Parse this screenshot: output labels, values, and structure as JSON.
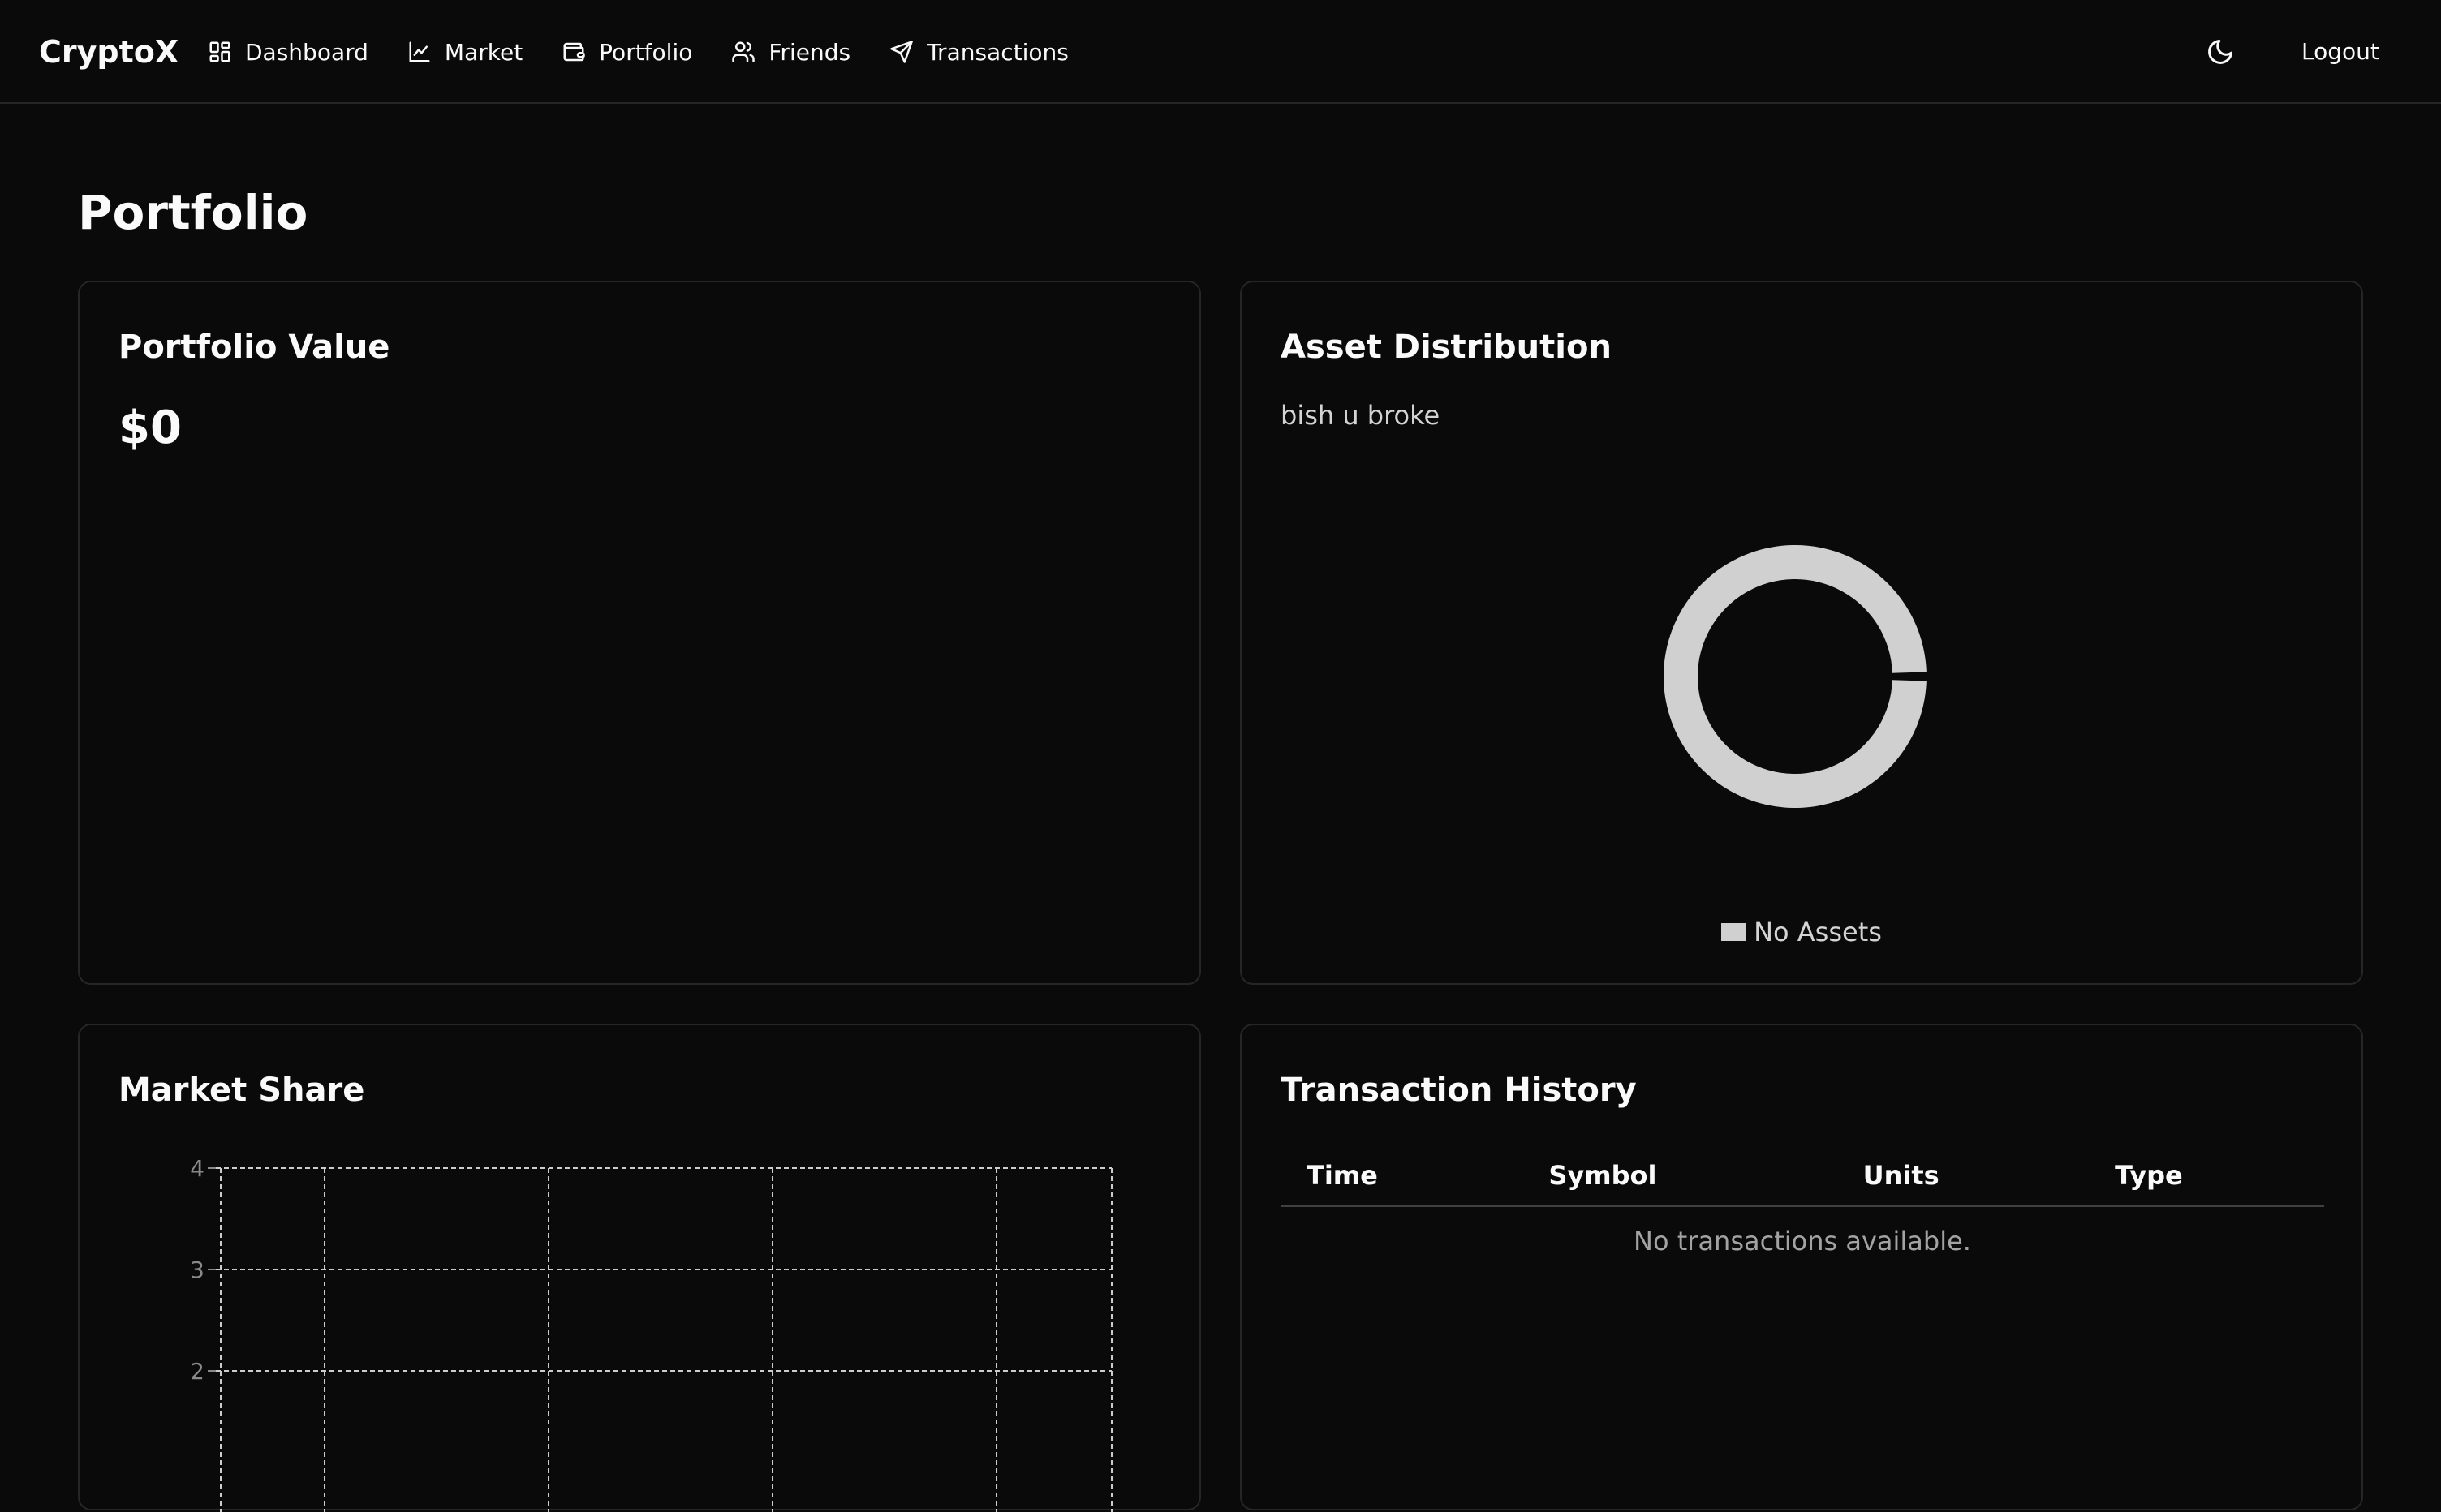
{
  "nav": {
    "brand": "CryptoX",
    "items": [
      {
        "label": "Dashboard",
        "icon": "dashboard-icon"
      },
      {
        "label": "Market",
        "icon": "chart-line-icon"
      },
      {
        "label": "Portfolio",
        "icon": "wallet-icon"
      },
      {
        "label": "Friends",
        "icon": "users-icon"
      },
      {
        "label": "Transactions",
        "icon": "send-icon"
      }
    ],
    "theme_icon": "moon-icon",
    "logout_label": "Logout"
  },
  "page": {
    "title": "Portfolio"
  },
  "portfolio_value": {
    "title": "Portfolio Value",
    "amount": "$0"
  },
  "asset_distribution": {
    "title": "Asset Distribution",
    "description": "bish u broke",
    "legend_label": "No Assets",
    "color": "#d0d0d0"
  },
  "market_share": {
    "title": "Market Share"
  },
  "transaction_history": {
    "title": "Transaction History",
    "columns": [
      "Time",
      "Symbol",
      "Units",
      "Type"
    ],
    "empty_message": "No transactions available."
  },
  "chart_data": [
    {
      "type": "pie",
      "labels": [
        "No Assets"
      ],
      "values": [
        1
      ],
      "colors": [
        "#d0d0d0"
      ],
      "donut": true,
      "legend": "bottom"
    },
    {
      "type": "bar",
      "categories": [],
      "values": [],
      "y_ticks": [
        "4",
        "3",
        "2"
      ],
      "grid": true,
      "grid_style": "dashed"
    }
  ],
  "colors": {
    "background": "#0a0a0a",
    "border": "#262626",
    "text": "#fafafa",
    "muted": "#a3a3a3",
    "grid": "#cccccc"
  }
}
